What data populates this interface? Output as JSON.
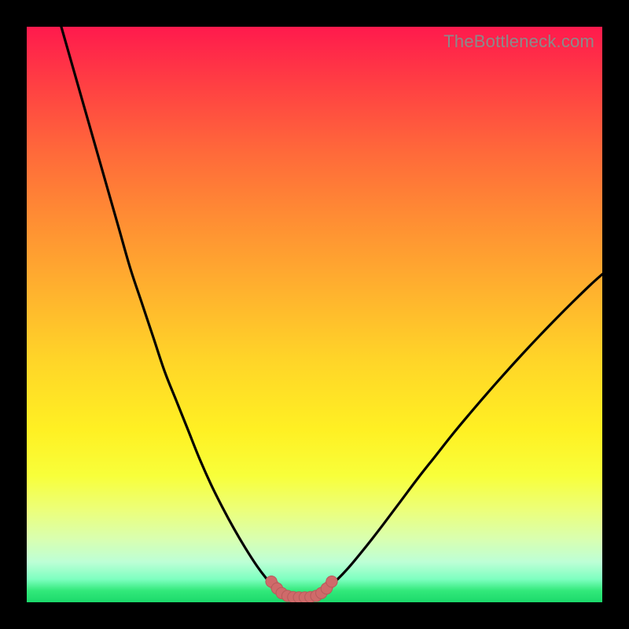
{
  "watermark": {
    "text": "TheBottleneck.com"
  },
  "colors": {
    "frame": "#000000",
    "curve": "#000000",
    "marker": "#cf6a6a",
    "marker_stroke": "#b75b5b"
  },
  "chart_data": {
    "type": "line",
    "title": "",
    "xlabel": "",
    "ylabel": "",
    "xlim": [
      0,
      100
    ],
    "ylim": [
      0,
      100
    ],
    "grid": false,
    "legend": false,
    "series": [
      {
        "name": "left-branch",
        "x": [
          6,
          8,
          10,
          12,
          14,
          16,
          18,
          20,
          22,
          24,
          26,
          28,
          30,
          32,
          34,
          36,
          38,
          40,
          41.5,
          43,
          44
        ],
        "y": [
          100,
          93,
          86,
          79,
          72,
          65,
          58,
          52,
          46,
          40,
          35,
          30,
          25,
          20.5,
          16.5,
          12.8,
          9.4,
          6.3,
          4.3,
          2.6,
          1.6
        ]
      },
      {
        "name": "right-branch",
        "x": [
          51,
          52,
          54,
          56,
          58,
          60,
          62,
          65,
          68,
          71,
          74,
          77,
          80,
          83,
          86,
          89,
          92,
          95,
          98,
          100
        ],
        "y": [
          1.6,
          2.3,
          4.0,
          6.1,
          8.5,
          11.0,
          13.6,
          17.6,
          21.6,
          25.4,
          29.2,
          32.8,
          36.3,
          39.7,
          43.0,
          46.2,
          49.3,
          52.3,
          55.2,
          57.0
        ]
      },
      {
        "name": "valley-floor",
        "x": [
          44,
          45,
          46,
          47,
          48,
          49,
          50,
          51
        ],
        "y": [
          1.6,
          1.1,
          0.9,
          0.85,
          0.85,
          0.9,
          1.1,
          1.6
        ]
      },
      {
        "name": "markers",
        "x": [
          42.5,
          43.5,
          44.3,
          45.3,
          46.3,
          47.3,
          48.3,
          49.3,
          50.3,
          51.2,
          52.1,
          53.0
        ],
        "y": [
          3.6,
          2.4,
          1.6,
          1.1,
          0.9,
          0.85,
          0.85,
          0.9,
          1.1,
          1.6,
          2.4,
          3.6
        ]
      }
    ]
  }
}
